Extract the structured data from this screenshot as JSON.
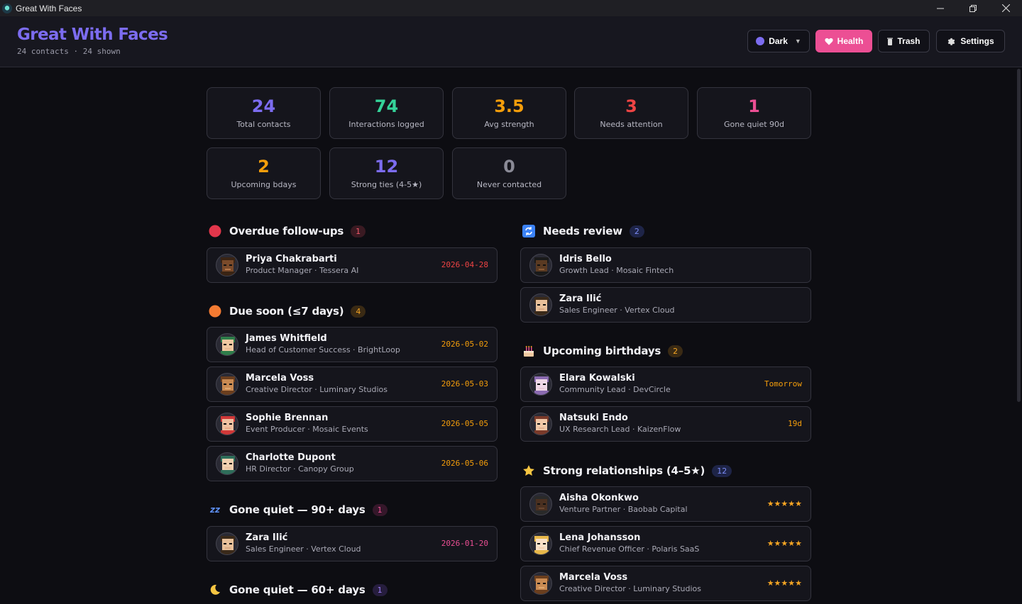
{
  "window": {
    "title": "Great With Faces"
  },
  "header": {
    "brand": "Great With Faces",
    "subtitle": "24 contacts · 24 shown",
    "theme_label": "Dark",
    "health_label": "Health",
    "trash_label": "Trash",
    "settings_label": "Settings"
  },
  "stats": [
    {
      "value": "24",
      "label": "Total contacts",
      "color": "#7c6cf0"
    },
    {
      "value": "74",
      "label": "Interactions logged",
      "color": "#34d399"
    },
    {
      "value": "3.5",
      "label": "Avg strength",
      "color": "#f59e0b"
    },
    {
      "value": "3",
      "label": "Needs attention",
      "color": "#ef4444"
    },
    {
      "value": "1",
      "label": "Gone quiet 90d",
      "color": "#ec4f94"
    },
    {
      "value": "2",
      "label": "Upcoming bdays",
      "color": "#f59e0b"
    },
    {
      "value": "12",
      "label": "Strong ties (4-5★)",
      "color": "#7c6cf0"
    },
    {
      "value": "0",
      "label": "Never contacted",
      "color": "#8a8a96"
    }
  ],
  "sections": {
    "overdue": {
      "title": "Overdue follow-ups",
      "count": "1",
      "icon": "red-circle-icon",
      "items": [
        {
          "name": "Priya Chakrabarti",
          "role": "Product Manager · Tessera AI",
          "meta": "2026-04-28",
          "meta_color": "#ef4444"
        }
      ]
    },
    "due_soon": {
      "title": "Due soon (≤7 days)",
      "count": "4",
      "icon": "orange-circle-icon",
      "items": [
        {
          "name": "James Whitfield",
          "role": "Head of Customer Success · BrightLoop",
          "meta": "2026-05-02",
          "meta_color": "#f59e0b"
        },
        {
          "name": "Marcela Voss",
          "role": "Creative Director · Luminary Studios",
          "meta": "2026-05-03",
          "meta_color": "#f59e0b"
        },
        {
          "name": "Sophie Brennan",
          "role": "Event Producer · Mosaic Events",
          "meta": "2026-05-05",
          "meta_color": "#f59e0b"
        },
        {
          "name": "Charlotte Dupont",
          "role": "HR Director · Canopy Group",
          "meta": "2026-05-06",
          "meta_color": "#f59e0b"
        }
      ]
    },
    "gone_quiet_90": {
      "title": "Gone quiet — 90+ days",
      "count": "1",
      "icon": "sleep-zzz-icon",
      "items": [
        {
          "name": "Zara Ilić",
          "role": "Sales Engineer · Vertex Cloud",
          "meta": "2026-01-20",
          "meta_color": "#ec4f94"
        }
      ]
    },
    "gone_quiet_60": {
      "title": "Gone quiet — 60+ days",
      "count": "1",
      "icon": "crescent-moon-icon"
    },
    "needs_review": {
      "title": "Needs review",
      "count": "2",
      "icon": "refresh-icon",
      "items": [
        {
          "name": "Idris Bello",
          "role": "Growth Lead · Mosaic Fintech"
        },
        {
          "name": "Zara Ilić",
          "role": "Sales Engineer · Vertex Cloud"
        }
      ]
    },
    "birthdays": {
      "title": "Upcoming birthdays",
      "count": "2",
      "icon": "birthday-cake-icon",
      "items": [
        {
          "name": "Elara Kowalski",
          "role": "Community Lead · DevCircle",
          "meta": "Tomorrow",
          "meta_color": "#f59e0b"
        },
        {
          "name": "Natsuki Endo",
          "role": "UX Research Lead · KaizenFlow",
          "meta": "19d",
          "meta_color": "#f59e0b"
        }
      ]
    },
    "strong": {
      "title": "Strong relationships (4–5★)",
      "count": "12",
      "icon": "star-icon",
      "items": [
        {
          "name": "Aisha Okonkwo",
          "role": "Venture Partner · Baobab Capital",
          "stars": "★★★★★"
        },
        {
          "name": "Lena Johansson",
          "role": "Chief Revenue Officer · Polaris SaaS",
          "stars": "★★★★★"
        },
        {
          "name": "Marcela Voss",
          "role": "Creative Director · Luminary Studios",
          "stars": "★★★★★"
        }
      ]
    }
  }
}
